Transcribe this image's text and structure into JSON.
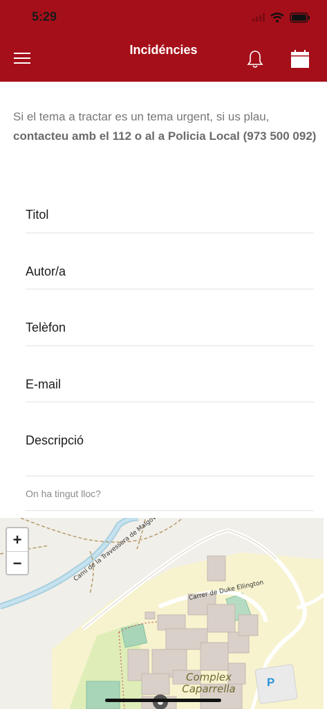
{
  "status_bar": {
    "time": "5:29"
  },
  "header": {
    "title": "Incidéncies",
    "background_color": "#a50f19",
    "left_icon": "menu-icon",
    "right_icons": [
      "bell-icon",
      "calendar-icon"
    ]
  },
  "intro": {
    "text": "Si el tema a tractar es un tema urgent, si us plau,",
    "bold_text": "contacteu amb el 112 o al a Policia Local (973 500 092)"
  },
  "form": {
    "fields": [
      {
        "label": "Titol"
      },
      {
        "label": "Autor/a"
      },
      {
        "label": "Telèfon"
      },
      {
        "label": "E-mail"
      },
      {
        "label": "Descripció"
      }
    ],
    "location_label": "On ha tingut lloc?"
  },
  "map": {
    "zoom_in": "+",
    "zoom_out": "−",
    "streets": [
      "Camí de la Travessera de Malgovern a la Caparrella",
      "Carrer de Duke Ellington"
    ],
    "place_label_line1": "Complex",
    "place_label_line2": "Caparrella",
    "parking_label": "P"
  }
}
